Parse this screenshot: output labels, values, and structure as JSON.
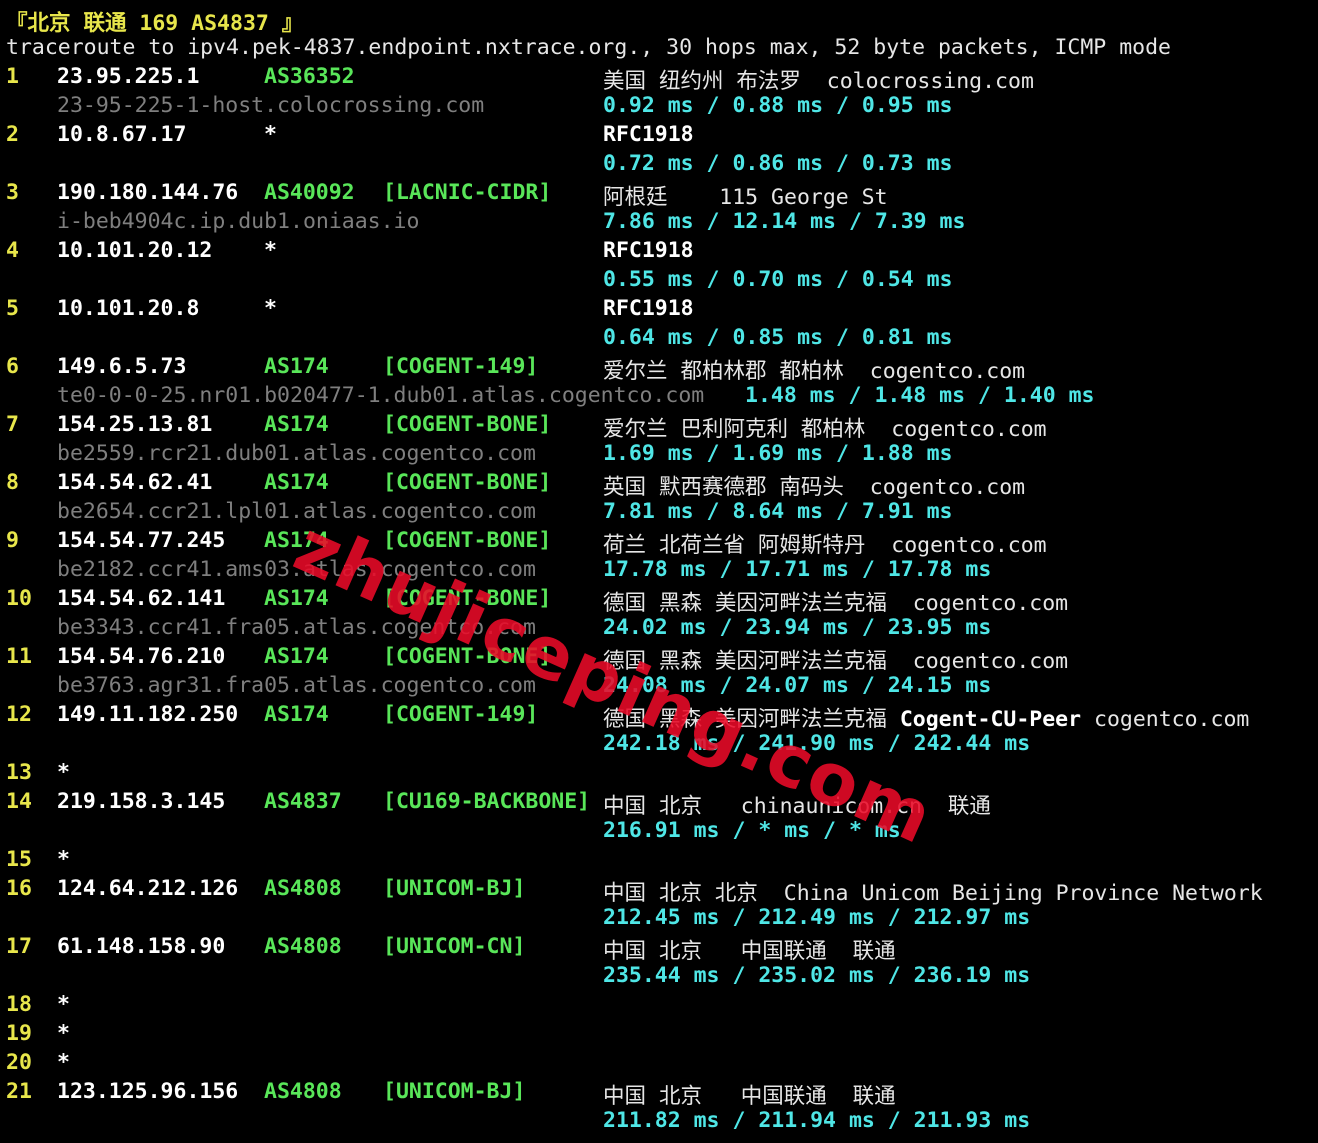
{
  "header": {
    "title": "『北京 联通 169 AS4837 』",
    "command": "traceroute to ipv4.pek-4837.endpoint.nxtrace.org., 30 hops max, 52 byte packets, ICMP mode"
  },
  "watermark": "zhujiceping.com",
  "hops": [
    {
      "num": "1",
      "ip": "23.95.225.1",
      "asn": "AS36352",
      "net": "",
      "geo": "美国 纽约州 布法罗  colocrossing.com",
      "host": "23-95-225-1-host.colocrossing.com",
      "rtt": "0.92 ms / 0.88 ms / 0.95 ms"
    },
    {
      "num": "2",
      "ip": "10.8.67.17",
      "asn": "*",
      "net": "",
      "geo": "RFC1918",
      "host": "",
      "rtt": "0.72 ms / 0.86 ms / 0.73 ms"
    },
    {
      "num": "3",
      "ip": "190.180.144.76",
      "asn": "AS40092",
      "net": "[LACNIC-CIDR]",
      "geo": "阿根廷    115 George St",
      "host": "i-beb4904c.ip.dub1.oniaas.io",
      "rtt": "7.86 ms / 12.14 ms / 7.39 ms"
    },
    {
      "num": "4",
      "ip": "10.101.20.12",
      "asn": "*",
      "net": "",
      "geo": "RFC1918",
      "host": "",
      "rtt": "0.55 ms / 0.70 ms / 0.54 ms"
    },
    {
      "num": "5",
      "ip": "10.101.20.8",
      "asn": "*",
      "net": "",
      "geo": "RFC1918",
      "host": "",
      "rtt": "0.64 ms / 0.85 ms / 0.81 ms"
    },
    {
      "num": "6",
      "ip": "149.6.5.73",
      "asn": "AS174",
      "net": "[COGENT-149]",
      "geo": "爱尔兰 都柏林郡 都柏林  cogentco.com",
      "host": "te0-0-0-25.nr01.b020477-1.dub01.atlas.cogentco.com",
      "rtt": "1.48 ms / 1.48 ms / 1.40 ms"
    },
    {
      "num": "7",
      "ip": "154.25.13.81",
      "asn": "AS174",
      "net": "[COGENT-BONE]",
      "geo": "爱尔兰 巴利阿克利 都柏林  cogentco.com",
      "host": "be2559.rcr21.dub01.atlas.cogentco.com",
      "rtt": "1.69 ms / 1.69 ms / 1.88 ms"
    },
    {
      "num": "8",
      "ip": "154.54.62.41",
      "asn": "AS174",
      "net": "[COGENT-BONE]",
      "geo": "英国 默西赛德郡 南码头  cogentco.com",
      "host": "be2654.ccr21.lpl01.atlas.cogentco.com",
      "rtt": "7.81 ms / 8.64 ms / 7.91 ms"
    },
    {
      "num": "9",
      "ip": "154.54.77.245",
      "asn": "AS174",
      "net": "[COGENT-BONE]",
      "geo": "荷兰 北荷兰省 阿姆斯特丹  cogentco.com",
      "host": "be2182.ccr41.ams03.atlas.cogentco.com",
      "rtt": "17.78 ms / 17.71 ms / 17.78 ms"
    },
    {
      "num": "10",
      "ip": "154.54.62.141",
      "asn": "AS174",
      "net": "[COGENT-BONE]",
      "geo": "德国 黑森 美因河畔法兰克福  cogentco.com",
      "host": "be3343.ccr41.fra05.atlas.cogentco.com",
      "rtt": "24.02 ms / 23.94 ms / 23.95 ms"
    },
    {
      "num": "11",
      "ip": "154.54.76.210",
      "asn": "AS174",
      "net": "[COGENT-BONE]",
      "geo": "德国 黑森 美因河畔法兰克福  cogentco.com",
      "host": "be3763.agr31.fra05.atlas.cogentco.com",
      "rtt": "24.08 ms / 24.07 ms / 24.15 ms"
    },
    {
      "num": "12",
      "ip": "149.11.182.250",
      "asn": "AS174",
      "net": "[COGENT-149]",
      "geo": "德国 黑森 美因河畔法兰克福 ",
      "geo_bold": "Cogent-CU-Peer",
      "geo_tail": " cogentco.com",
      "host": "",
      "rtt": "242.18 ms / 241.90 ms / 242.44 ms"
    },
    {
      "num": "13",
      "ip": "*",
      "asn": "",
      "net": "",
      "geo": "",
      "host": "",
      "rtt": ""
    },
    {
      "num": "14",
      "ip": "219.158.3.145",
      "asn": "AS4837",
      "net": "[CU169-BACKBONE]",
      "geo": "中国 北京   chinaunicom.cn  联通",
      "host": "",
      "rtt": "216.91 ms / * ms / * ms"
    },
    {
      "num": "15",
      "ip": "*",
      "asn": "",
      "net": "",
      "geo": "",
      "host": "",
      "rtt": ""
    },
    {
      "num": "16",
      "ip": "124.64.212.126",
      "asn": "AS4808",
      "net": "[UNICOM-BJ]",
      "geo": "中国 北京 北京  China Unicom Beijing Province Network",
      "host": "",
      "rtt": "212.45 ms / 212.49 ms / 212.97 ms"
    },
    {
      "num": "17",
      "ip": "61.148.158.90",
      "asn": "AS4808",
      "net": "[UNICOM-CN]",
      "geo": "中国 北京   中国联通  联通",
      "host": "",
      "rtt": "235.44 ms / 235.02 ms / 236.19 ms"
    },
    {
      "num": "18",
      "ip": "*",
      "asn": "",
      "net": "",
      "geo": "",
      "host": "",
      "rtt": ""
    },
    {
      "num": "19",
      "ip": "*",
      "asn": "",
      "net": "",
      "geo": "",
      "host": "",
      "rtt": ""
    },
    {
      "num": "20",
      "ip": "*",
      "asn": "",
      "net": "",
      "geo": "",
      "host": "",
      "rtt": ""
    },
    {
      "num": "21",
      "ip": "123.125.96.156",
      "asn": "AS4808",
      "net": "[UNICOM-BJ]",
      "geo": "中国 北京   中国联通  联通",
      "host": "",
      "rtt": "211.82 ms / 211.94 ms / 211.93 ms"
    }
  ]
}
